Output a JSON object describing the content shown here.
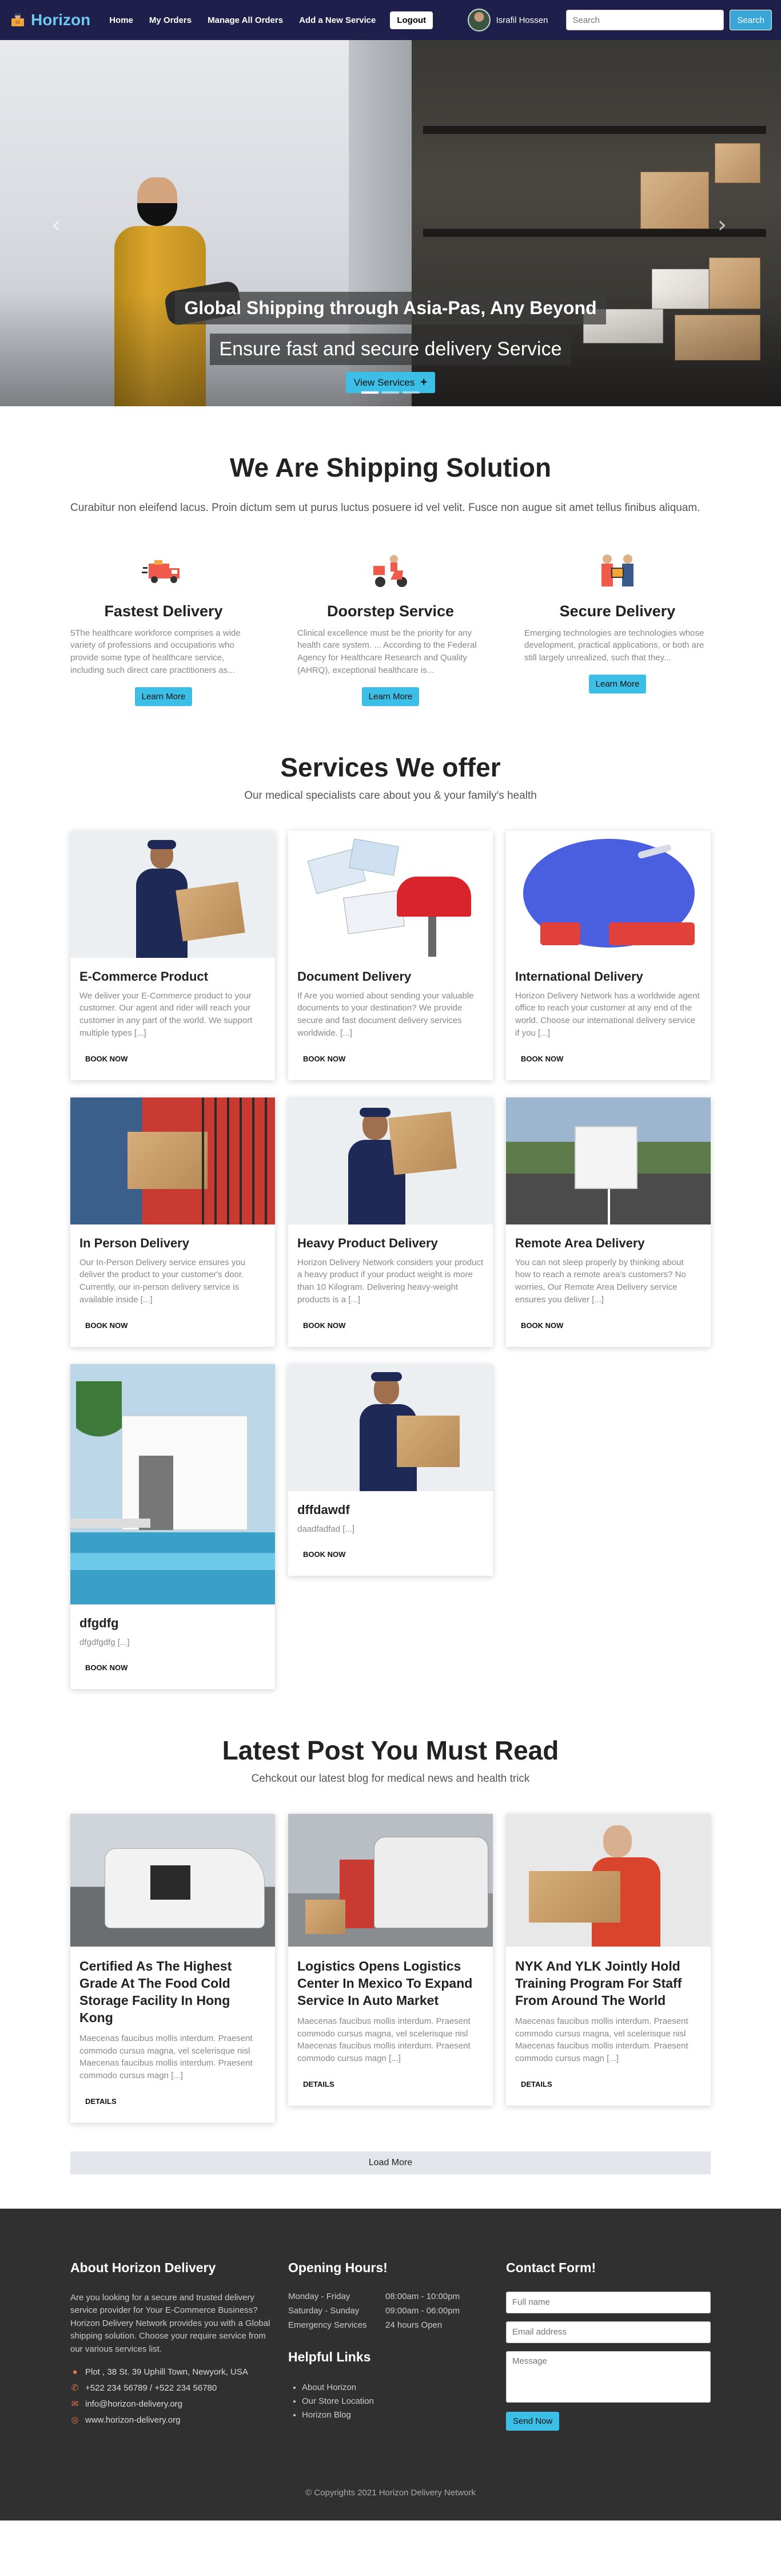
{
  "navbar": {
    "brand": "Horizon",
    "links": [
      "Home",
      "My Orders",
      "Manage All Orders",
      "Add a New Service"
    ],
    "logout": "Logout",
    "user_name": "Israfil Hossen",
    "search_placeholder": "Search",
    "search_button": "Search"
  },
  "hero": {
    "title": "Global Shipping through Asia-Pas, Any Beyond",
    "subtitle": "Ensure fast and secure delivery Service",
    "button": "View Services",
    "button_icon": "+",
    "prev_arrow": "‹",
    "next_arrow": "›"
  },
  "solution": {
    "title": "We Are Shipping Solution",
    "description": "Curabitur non eleifend lacus. Proin dictum sem ut purus luctus posuere id vel velit. Fusce non augue sit amet tellus finibus aliquam.",
    "features": [
      {
        "title": "Fastest Delivery",
        "icon": "delivery-truck-icon",
        "text": "5The healthcare workforce comprises a wide variety of professions and occupations who provide some type of healthcare service, including such direct care practitioners as...",
        "button": "Learn More"
      },
      {
        "title": "Doorstep Service",
        "icon": "delivery-scooter-icon",
        "text": "Clinical excellence must be the priority for any health care system. ... According to the Federal Agency for Healthcare Research and Quality (AHRQ), exceptional healthcare is...",
        "button": "Learn More"
      },
      {
        "title": "Secure Delivery",
        "icon": "handover-package-icon",
        "text": "Emerging technologies are technologies whose development, practical applications, or both are still largely unrealized, such that they...",
        "button": "Learn More"
      }
    ]
  },
  "services": {
    "title": "Services We offer",
    "subtitle": "Our medical specialists care about you & your family's health",
    "button": "BOOK NOW",
    "items": [
      {
        "title": "E-Commerce Product",
        "text": "We deliver your E-Commerce product to your customer. Our agent and rider will reach your customer in any part of the world. We support multiple types [...]"
      },
      {
        "title": "Document Delivery",
        "text": "If Are you worried about sending your valuable documents to your destination? We provide secure and fast document delivery services worldwide. [...]"
      },
      {
        "title": "International Delivery",
        "text": "Horizon Delivery Network has a worldwide agent office to reach your customer at any end of the world. Choose our international delivery service if you [...]"
      },
      {
        "title": "In Person Delivery",
        "text": "Our In-Person Delivery service ensures you deliver the product to your customer's door. Currently, our in-person delivery service is available inside [...]"
      },
      {
        "title": "Heavy Product Delivery",
        "text": "Horizon Delivery Network considers your product a heavy product if your product weight is more than 10 Kilogram. Delivering heavy-weight products is a [...]"
      },
      {
        "title": "Remote Area Delivery",
        "text": "You can not sleep properly by thinking about how to reach a remote area's customers? No worries, Our Remote Area Delivery service ensures you deliver [...]"
      },
      {
        "title": "dfgdfg",
        "text": "dfgdfgdfg [...]"
      },
      {
        "title": "dffdawdf",
        "text": "daadfadfad [...]"
      }
    ]
  },
  "blog": {
    "title": "Latest Post You Must Read",
    "subtitle": "Cehckout our latest blog for medical news and health trick",
    "button": "DETAILS",
    "load_more": "Load More",
    "posts": [
      {
        "title": "Certified As The Highest Grade At The Food Cold Storage Facility In Hong Kong",
        "text": "Maecenas faucibus mollis interdum. Praesent commodo cursus magna, vel scelerisque nisl Maecenas faucibus mollis interdum. Praesent commodo cursus magn [...]"
      },
      {
        "title": "Logistics Opens Logistics Center In Mexico To Expand Service In Auto Market",
        "text": "Maecenas faucibus mollis interdum. Praesent commodo cursus magna, vel scelerisque nisl Maecenas faucibus mollis interdum. Praesent commodo cursus magn [...]"
      },
      {
        "title": "NYK And YLK Jointly Hold Training Program For Staff From Around The World",
        "text": "Maecenas faucibus mollis interdum. Praesent commodo cursus magna, vel scelerisque nisl Maecenas faucibus mollis interdum. Praesent commodo cursus magn [...]"
      }
    ]
  },
  "footer": {
    "about_title": "About Horizon Delivery",
    "about_text": "Are you looking for a secure and trusted delivery service provider for Your E-Commerce Business? Horizon Delivery Network provides you with a Global shipping solution. Choose your require service from our various services list.",
    "address": "Plot , 38 St. 39 Uphill Town, Newyork, USA",
    "phone": "+522 234 56789 / +522 234 56780",
    "email": "info@horizon-delivery.org",
    "website": "www.horizon-delivery.org",
    "hours_title": "Opening Hours!",
    "hours": [
      {
        "day": "Monday - Friday",
        "time": "08:00am - 10:00pm"
      },
      {
        "day": "Saturday - Sunday",
        "time": "09:00am - 06:00pm"
      },
      {
        "day": "Emergency Services",
        "time": "24 hours Open"
      }
    ],
    "help_title": "Helpful Links",
    "help_links": [
      "About Horizon",
      "Our Store Location",
      "Horizon Blog"
    ],
    "contact_title": "Contact Form!",
    "fullname_placeholder": "Full name",
    "email_placeholder": "Email address",
    "message_placeholder": "Message",
    "send_button": "Send Now",
    "copyright": "© Copyrights 2021 Horizon Delivery Network"
  },
  "colors": {
    "navbar": "#1e1f4a",
    "accent": "#3bbfe6",
    "brand": "#6ec8f0",
    "footer": "#303030"
  }
}
